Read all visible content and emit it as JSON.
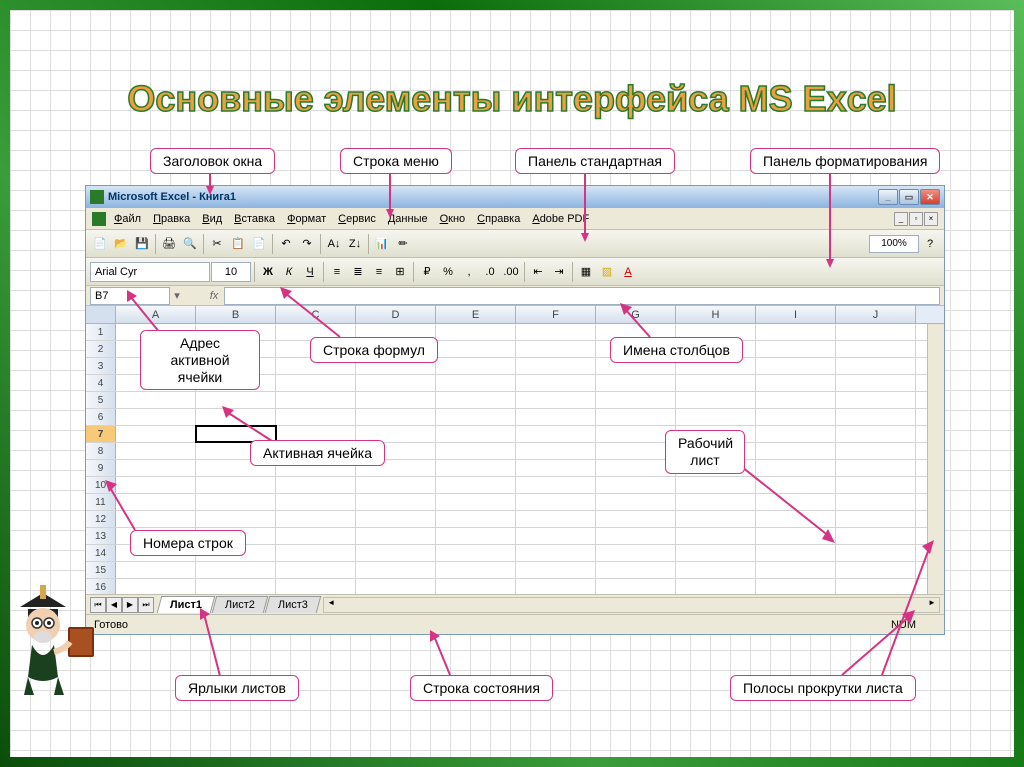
{
  "slide": {
    "title": "Основные элементы интерфейса MS Excel"
  },
  "callouts": {
    "window_title": "Заголовок окна",
    "menu_bar": "Строка меню",
    "standard_panel": "Панель стандартная",
    "formatting_panel": "Панель форматирования",
    "cell_address": "Адрес\nактивной ячейки",
    "formula_bar": "Строка формул",
    "column_names": "Имена столбцов",
    "active_cell": "Активная ячейка",
    "worksheet": "Рабочий\nлист",
    "row_numbers": "Номера строк",
    "sheet_tabs": "Ярлыки листов",
    "status_bar": "Строка состояния",
    "scrollbars": "Полосы прокрутки листа"
  },
  "excel": {
    "title": "Microsoft Excel - Книга1",
    "menu": [
      "Файл",
      "Правка",
      "Вид",
      "Вставка",
      "Формат",
      "Сервис",
      "Данные",
      "Окно",
      "Справка",
      "Adobe PDF"
    ],
    "font": "Arial Cyr",
    "font_size": "10",
    "zoom": "100%",
    "name_box": "B7",
    "columns": [
      "A",
      "B",
      "C",
      "D",
      "E",
      "F",
      "G",
      "H",
      "I",
      "J"
    ],
    "rows": [
      "1",
      "2",
      "3",
      "4",
      "5",
      "6",
      "7",
      "8",
      "9",
      "10",
      "11",
      "12",
      "13",
      "14",
      "15",
      "16"
    ],
    "active_row": 7,
    "active_col": "B",
    "sheets": [
      "Лист1",
      "Лист2",
      "Лист3"
    ],
    "active_sheet": 0,
    "status": "Готово",
    "num_indicator": "NUM"
  }
}
